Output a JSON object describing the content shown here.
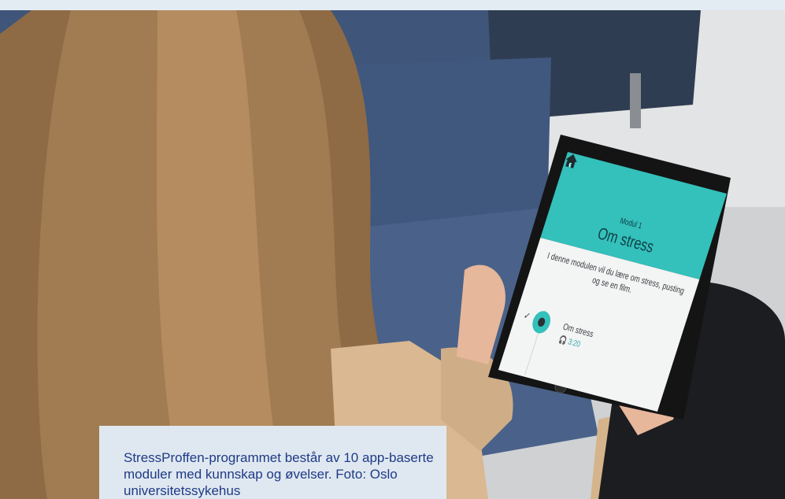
{
  "tablet_screen": {
    "back_icon": "chevron-left-icon",
    "home_icon": "home-icon",
    "module_label": "Modul 1",
    "title": "Om stress",
    "description": "I denne modulen vil du lære om stress, pusting og se en film.",
    "track": {
      "status_icon": "check-icon",
      "title": "Om stress",
      "duration": "3:20",
      "media_icon": "headphones-icon"
    },
    "colors": {
      "header": "#34c0bb",
      "body": "#f3f4f4"
    }
  },
  "caption": {
    "text": "StressProffen-programmet består av 10 app-baserte moduler med kunnskap og øvelser. Foto: Oslo universitetssykehus"
  },
  "colors": {
    "caption_background": "#dfe8f0",
    "caption_text": "#1f3a87"
  }
}
